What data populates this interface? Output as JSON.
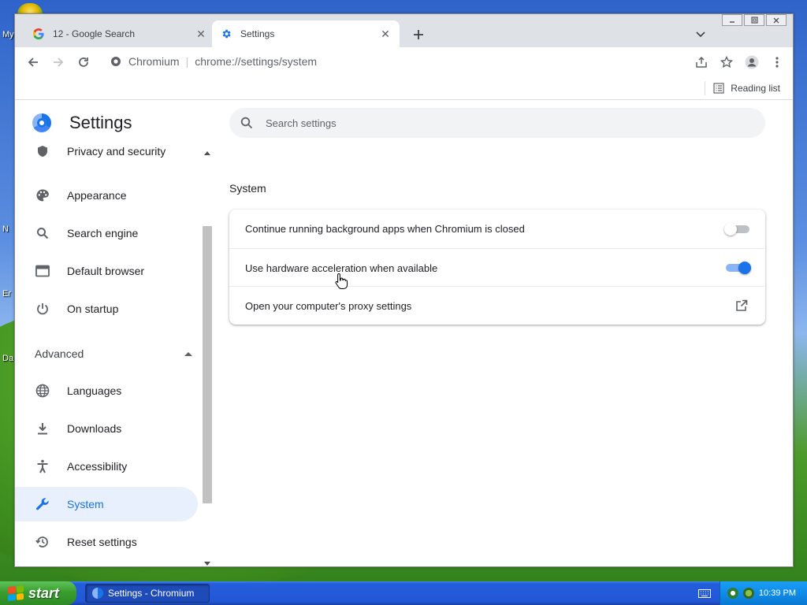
{
  "desktop": {
    "labels": [
      "My",
      "N",
      "Er",
      "Da"
    ]
  },
  "browser": {
    "tabs": [
      {
        "title": "12 - Google Search",
        "icon": "google-icon",
        "active": false
      },
      {
        "title": "Settings",
        "icon": "gear-icon",
        "active": true
      }
    ],
    "omnibox": {
      "site_name": "Chromium",
      "separator": "|",
      "url_scheme": "chrome://",
      "url_path": "settings/system"
    },
    "bookmarks_bar": {
      "reading_list_label": "Reading list"
    }
  },
  "settings": {
    "title": "Settings",
    "search_placeholder": "Search settings",
    "sidebar": {
      "partial_item": "Privacy and security",
      "items": [
        {
          "label": "Appearance",
          "icon": "palette-icon"
        },
        {
          "label": "Search engine",
          "icon": "search-icon"
        },
        {
          "label": "Default browser",
          "icon": "browser-window-icon"
        },
        {
          "label": "On startup",
          "icon": "power-icon"
        }
      ],
      "advanced_label": "Advanced",
      "advanced_items": [
        {
          "label": "Languages",
          "icon": "globe-icon"
        },
        {
          "label": "Downloads",
          "icon": "download-icon"
        },
        {
          "label": "Accessibility",
          "icon": "accessibility-icon"
        },
        {
          "label": "System",
          "icon": "wrench-icon",
          "selected": true
        },
        {
          "label": "Reset settings",
          "icon": "history-icon"
        }
      ]
    },
    "system": {
      "section_title": "System",
      "rows": [
        {
          "label": "Continue running background apps when Chromium is closed",
          "control": "toggle",
          "on": false
        },
        {
          "label": "Use hardware acceleration when available",
          "control": "toggle",
          "on": true
        },
        {
          "label": "Open your computer's proxy settings",
          "control": "external-link"
        }
      ]
    }
  },
  "taskbar": {
    "start_label": "start",
    "task_item_label": "Settings - Chromium",
    "clock": "10:39 PM"
  },
  "colors": {
    "accent": "#1a73e8",
    "selected_nav_bg": "#e8f0fe"
  }
}
